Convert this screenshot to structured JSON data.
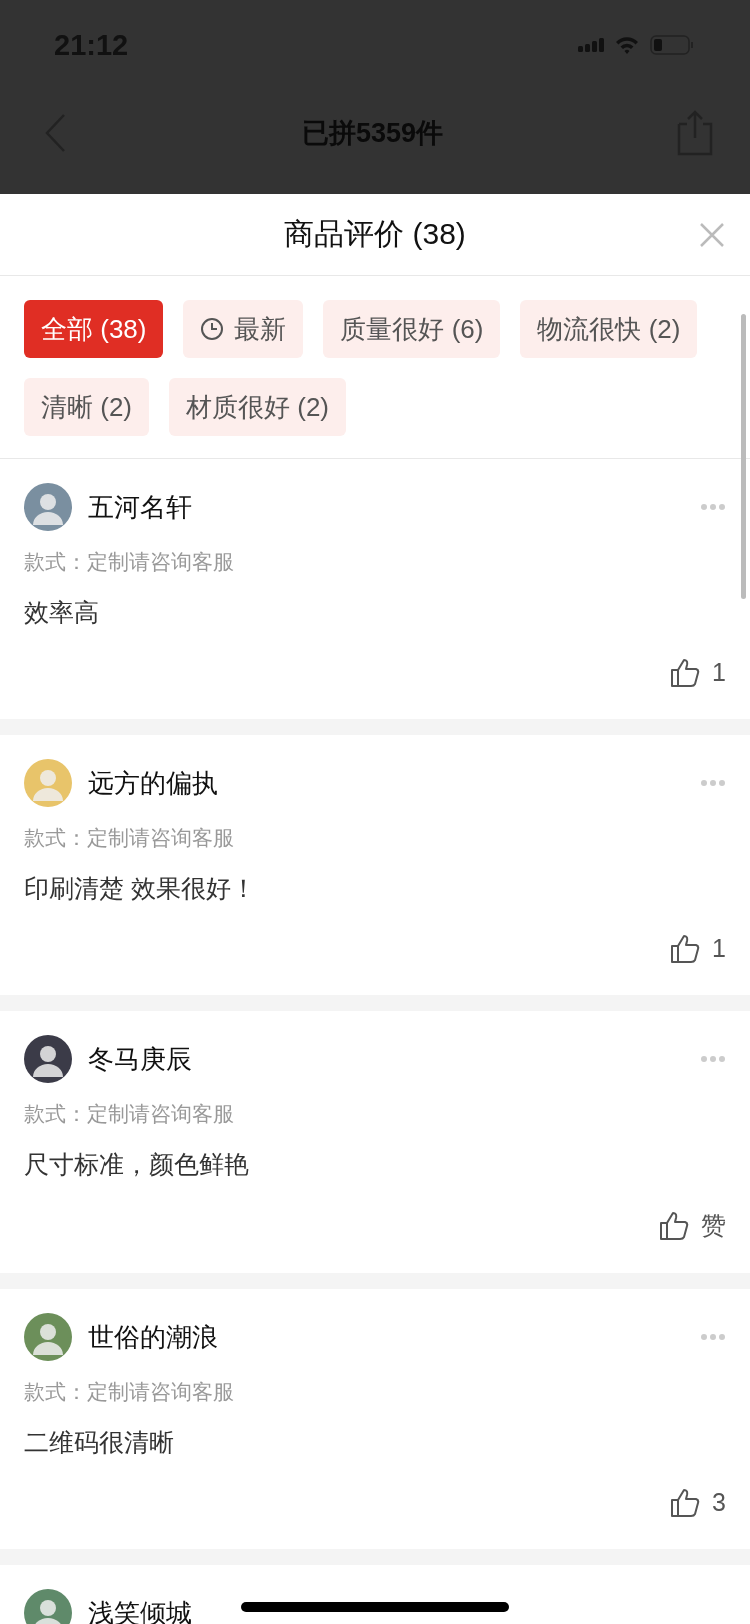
{
  "status_bar": {
    "time": "21:12"
  },
  "nav_bar": {
    "title": "已拼5359件"
  },
  "sheet": {
    "title": "商品评价 (38)"
  },
  "filters": [
    {
      "label": "全部 (38)",
      "selected": true
    },
    {
      "label": "最新",
      "selected": false,
      "kind": "clock"
    },
    {
      "label": "质量很好 (6)",
      "selected": false
    },
    {
      "label": "物流很快 (2)",
      "selected": false
    },
    {
      "label": "清晰 (2)",
      "selected": false
    },
    {
      "label": "材质很好 (2)",
      "selected": false
    }
  ],
  "reviews": [
    {
      "name": "五河名轩",
      "style": "款式：定制请咨询客服",
      "content": "效率高",
      "likes": "1"
    },
    {
      "name": "远方的偏执",
      "style": "款式：定制请咨询客服",
      "content": "印刷清楚 效果很好！",
      "likes": "1"
    },
    {
      "name": "冬马庚辰",
      "style": "款式：定制请咨询客服",
      "content": "尺寸标准，颜色鲜艳",
      "likes": "赞"
    },
    {
      "name": "世俗的潮浪",
      "style": "款式：定制请咨询客服",
      "content": "二维码很清晰",
      "likes": "3"
    },
    {
      "name": "浅笑倾城"
    }
  ]
}
